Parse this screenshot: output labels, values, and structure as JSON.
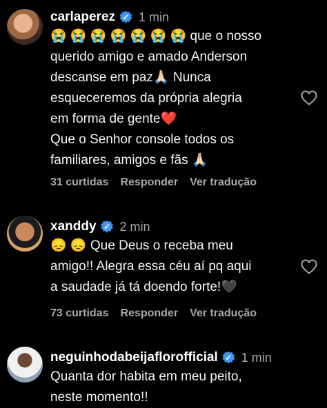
{
  "comments": [
    {
      "username": "carlaperez",
      "time": "1 min",
      "text": "😭 😭 😭 😭 😭 😭 😭  que o nosso\nquerido amigo e amado Anderson\ndescanse em paz🙏🏻 Nunca\nesqueceremos da própria alegria\nem forma de gente❤️\nQue o Senhor console todos os\nfamiliares, amigos e fãs 🙏🏻",
      "likes": "31 curtidas",
      "reply": "Responder",
      "translate": "Ver tradução"
    },
    {
      "username": "xanddy",
      "time": "2 min",
      "text": "😞 😞  Que Deus o receba meu\namigo!! Alegra essa céu aí pq aqui\na saudade já tá doendo forte!🖤",
      "likes": "73 curtidas",
      "reply": "Responder",
      "translate": "Ver tradução"
    },
    {
      "username": "neguinhodabeijaflorofficial",
      "time": "1 min",
      "text": "Quanta dor habita em meu peito,\nneste momento!!"
    }
  ],
  "verified_color": "#3d95ef"
}
